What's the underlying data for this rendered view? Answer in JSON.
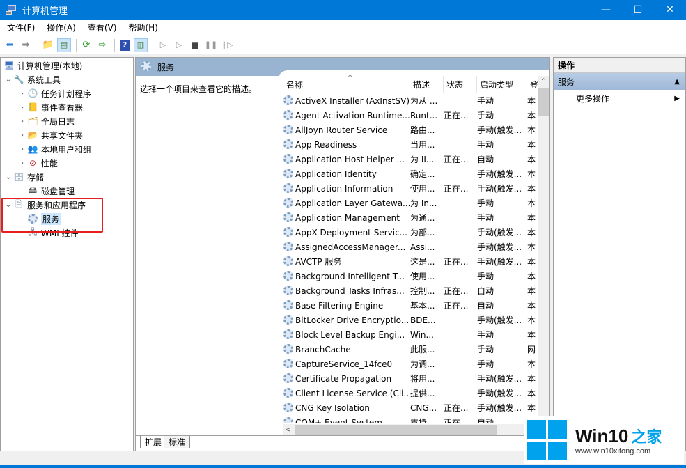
{
  "window": {
    "title": "计算机管理",
    "controls": {
      "minimize": "—",
      "maximize": "☐",
      "close": "✕"
    }
  },
  "menu": [
    "文件(F)",
    "操作(A)",
    "查看(V)",
    "帮助(H)"
  ],
  "toolbar": {
    "buttons": [
      "back-icon",
      "forward-icon",
      "up-folder-icon",
      "show-hide-tree-icon",
      "refresh-icon",
      "export-list-icon",
      "help-icon",
      "show-hide-action-pane-icon",
      "start-icon",
      "start-alt-icon",
      "stop-icon",
      "pause-icon",
      "resume-icon"
    ]
  },
  "tree": {
    "root": "计算机管理(本地)",
    "items": [
      {
        "label": "系统工具",
        "level": 1,
        "expanded": true
      },
      {
        "label": "任务计划程序",
        "level": 2
      },
      {
        "label": "事件查看器",
        "level": 2
      },
      {
        "label": "全局日志",
        "level": 2
      },
      {
        "label": "共享文件夹",
        "level": 2
      },
      {
        "label": "本地用户和组",
        "level": 2
      },
      {
        "label": "性能",
        "level": 2
      },
      {
        "label": "存储",
        "level": 1,
        "expanded": true
      },
      {
        "label": "磁盘管理",
        "level": 2
      },
      {
        "label": "服务和应用程序",
        "level": 1,
        "expanded": true
      },
      {
        "label": "服务",
        "level": 2,
        "selected": true
      },
      {
        "label": "WMI 控件",
        "level": 2
      }
    ]
  },
  "center": {
    "header": "服务",
    "description": "选择一个项目来查看它的描述。",
    "columns": [
      "名称",
      "描述",
      "状态",
      "启动类型",
      "登"
    ],
    "rows": [
      [
        "ActiveX Installer (AxInstSV)",
        "为从 ...",
        "",
        "手动",
        "本"
      ],
      [
        "Agent Activation Runtime...",
        "Runt...",
        "正在...",
        "手动",
        "本"
      ],
      [
        "AllJoyn Router Service",
        "路由...",
        "",
        "手动(触发...",
        "本"
      ],
      [
        "App Readiness",
        "当用...",
        "",
        "手动",
        "本"
      ],
      [
        "Application Host Helper ...",
        "为 II...",
        "正在...",
        "自动",
        "本"
      ],
      [
        "Application Identity",
        "确定...",
        "",
        "手动(触发...",
        "本"
      ],
      [
        "Application Information",
        "使用...",
        "正在...",
        "手动(触发...",
        "本"
      ],
      [
        "Application Layer Gatewa...",
        "为 In...",
        "",
        "手动",
        "本"
      ],
      [
        "Application Management",
        "为通...",
        "",
        "手动",
        "本"
      ],
      [
        "AppX Deployment Servic...",
        "为部...",
        "",
        "手动(触发...",
        "本"
      ],
      [
        "AssignedAccessManager...",
        "Assi...",
        "",
        "手动(触发...",
        "本"
      ],
      [
        "AVCTP 服务",
        "这是...",
        "正在...",
        "手动(触发...",
        "本"
      ],
      [
        "Background Intelligent T...",
        "使用...",
        "",
        "手动",
        "本"
      ],
      [
        "Background Tasks Infras...",
        "控制...",
        "正在...",
        "自动",
        "本"
      ],
      [
        "Base Filtering Engine",
        "基本...",
        "正在...",
        "自动",
        "本"
      ],
      [
        "BitLocker Drive Encryptio...",
        "BDE...",
        "",
        "手动(触发...",
        "本"
      ],
      [
        "Block Level Backup Engi...",
        "Win...",
        "",
        "手动",
        "本"
      ],
      [
        "BranchCache",
        "此服...",
        "",
        "手动",
        "网"
      ],
      [
        "CaptureService_14fce0",
        "为调...",
        "",
        "手动",
        "本"
      ],
      [
        "Certificate Propagation",
        "将用...",
        "",
        "手动(触发...",
        "本"
      ],
      [
        "Client License Service (Cli...",
        "提供...",
        "",
        "手动(触发...",
        "本"
      ],
      [
        "CNG Key Isolation",
        "CNG...",
        "正在...",
        "手动(触发...",
        "本"
      ],
      [
        "COM+ Event System",
        "支持...",
        "正在...",
        "自动",
        "本"
      ]
    ],
    "tabs": [
      "扩展",
      "标准"
    ],
    "active_tab": "扩展"
  },
  "actions": {
    "header": "操作",
    "section": "服务",
    "items": [
      "更多操作"
    ]
  },
  "watermark": {
    "brand": "Win10",
    "brand_cn": "之家",
    "url": "www.win10xitong.com"
  },
  "colors": {
    "titlebar": "#0078d7",
    "pane_header": "#99b4d1",
    "highlight_box": "#e81e1e",
    "selection": "#cce8ff"
  }
}
